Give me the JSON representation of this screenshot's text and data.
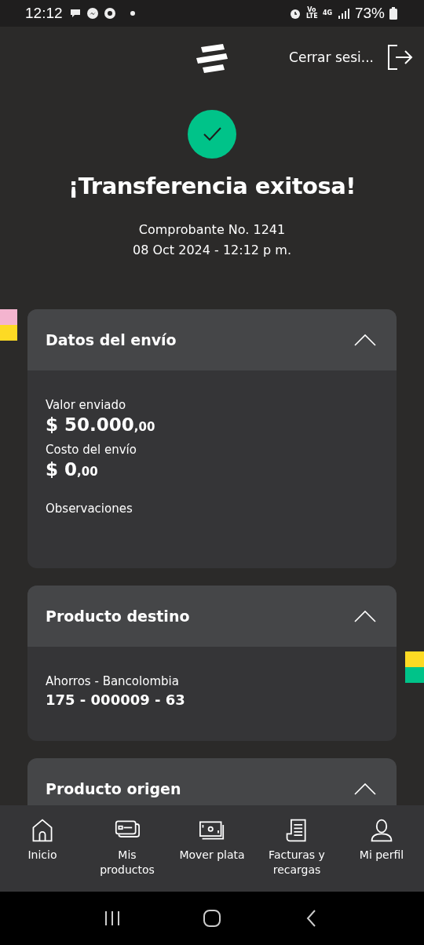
{
  "status_bar": {
    "time": "12:12",
    "network_labels": [
      "Vo LTE",
      "4G"
    ],
    "battery": "73%"
  },
  "header": {
    "logout_label": "Cerrar sesi..."
  },
  "result": {
    "title": "¡Transferencia exitosa!",
    "receipt": "Comprobante No. 1241",
    "datetime": "08 Oct 2024 - 12:12 p m."
  },
  "sections": [
    {
      "title": "Datos del envío",
      "expanded": true,
      "fields": [
        {
          "kind": "amount",
          "label": "Valor enviado",
          "value": "$ 50.000",
          "cents": ",00"
        },
        {
          "kind": "amount",
          "label": "Costo del envío",
          "value": "$ 0",
          "cents": ",00"
        },
        {
          "kind": "note",
          "label": "Observaciones"
        }
      ]
    },
    {
      "title": "Producto destino",
      "expanded": true,
      "fields": [
        {
          "kind": "account",
          "label": "Ahorros - Bancolombia",
          "value": "175 - 000009 - 63"
        }
      ]
    },
    {
      "title": "Producto origen",
      "expanded": true
    }
  ],
  "bottom_nav": [
    {
      "kind": "home",
      "label": "Inicio"
    },
    {
      "kind": "cards",
      "label": "Mis productos"
    },
    {
      "kind": "money",
      "label": "Mover plata"
    },
    {
      "kind": "bill",
      "label": "Facturas y recargas"
    },
    {
      "kind": "profile",
      "label": "Mi perfil"
    }
  ]
}
